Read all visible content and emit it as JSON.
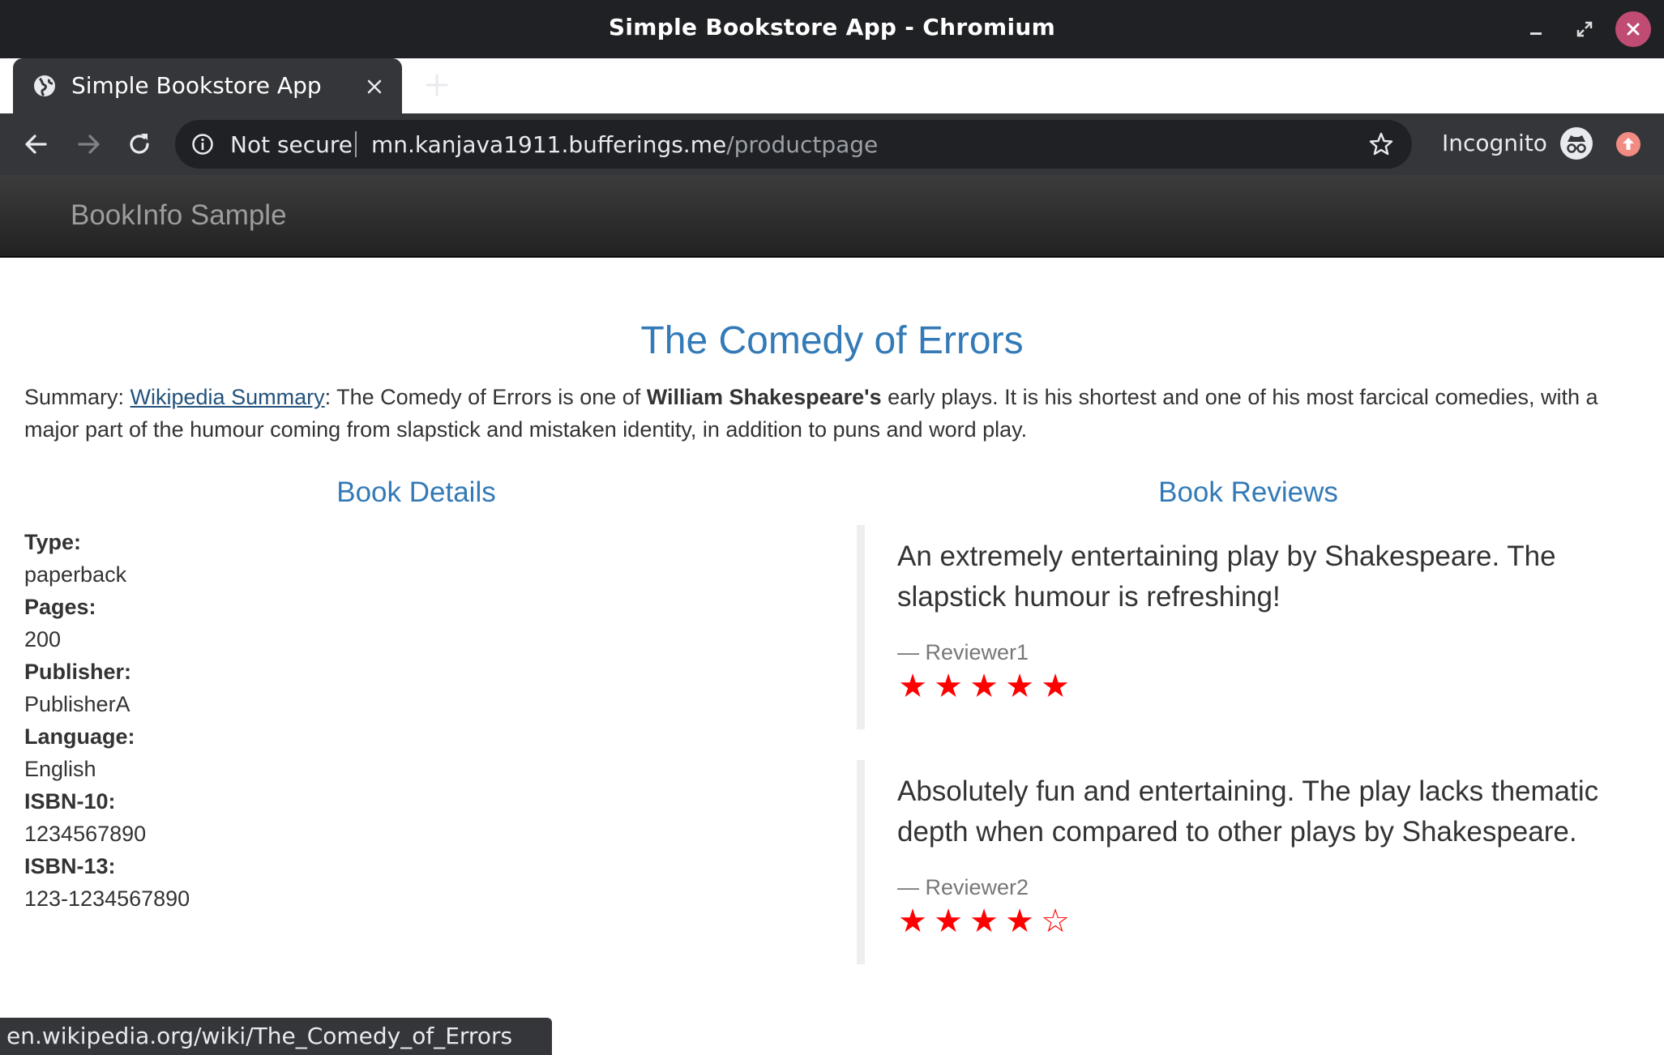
{
  "window": {
    "title": "Simple Bookstore App - Chromium"
  },
  "tab": {
    "title": "Simple Bookstore App",
    "favicon": "globe-icon"
  },
  "omnibox": {
    "security_label": "Not secure",
    "url_host": "mn.kanjava1911.bufferings.me",
    "url_path": "/productpage"
  },
  "profile": {
    "label": "Incognito"
  },
  "navbar": {
    "brand": "BookInfo Sample"
  },
  "book": {
    "title": "The Comedy of Errors",
    "summary_prefix": "Summary: ",
    "summary_link": "Wikipedia Summary",
    "summary_part1": ": The Comedy of Errors is one of ",
    "summary_bold": "William Shakespeare's",
    "summary_part2": " early plays. It is his shortest and one of his most farcical comedies, with a major part of the humour coming from slapstick and mistaken identity, in addition to puns and word play."
  },
  "details": {
    "heading": "Book Details",
    "items": [
      {
        "label": "Type:",
        "value": "paperback"
      },
      {
        "label": "Pages:",
        "value": "200"
      },
      {
        "label": "Publisher:",
        "value": "PublisherA"
      },
      {
        "label": "Language:",
        "value": "English"
      },
      {
        "label": "ISBN-10:",
        "value": "1234567890"
      },
      {
        "label": "ISBN-13:",
        "value": "123-1234567890"
      }
    ]
  },
  "reviews": {
    "heading": "Book Reviews",
    "items": [
      {
        "text": "An extremely entertaining play by Shakespeare. The slapstick humour is refreshing!",
        "reviewer": "— Reviewer1",
        "rating": 5,
        "max_rating": 5
      },
      {
        "text": "Absolutely fun and entertaining. The play lacks thematic depth when compared to other plays by Shakespeare.",
        "reviewer": "— Reviewer2",
        "rating": 4,
        "max_rating": 5
      }
    ],
    "star_color": "#ff0000"
  },
  "status_bar": {
    "text": "en.wikipedia.org/wiki/The_Comedy_of_Errors"
  },
  "colors": {
    "link": "#337ab7",
    "chrome_dark": "#202124",
    "chrome_toolbar": "#35363a",
    "close_button": "#c04b73"
  }
}
